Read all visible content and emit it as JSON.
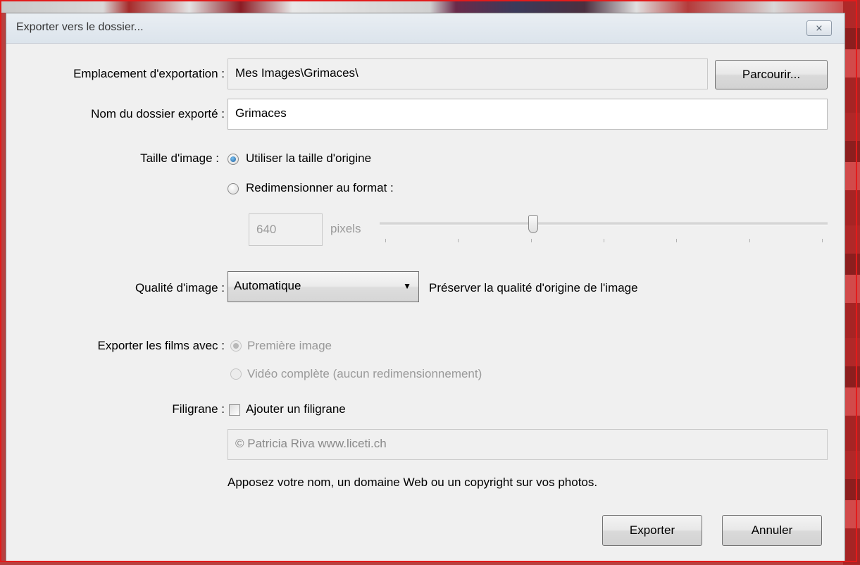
{
  "window": {
    "title": "Exporter vers le dossier...",
    "close_glyph": "⨯"
  },
  "export_location": {
    "label": "Emplacement d'exportation :",
    "value": "Mes Images\\Grimaces\\",
    "browse_label": "Parcourir..."
  },
  "folder_name": {
    "label": "Nom du dossier exporté :",
    "value": "Grimaces"
  },
  "image_size": {
    "label": "Taille d'image :",
    "option_original": "Utiliser la taille d'origine",
    "option_resize": "Redimensionner au format :",
    "pixels_value": "640",
    "pixels_unit": "pixels",
    "slider_fraction": 0.34
  },
  "image_quality": {
    "label": "Qualité d'image :",
    "selected": "Automatique",
    "description": "Préserver la qualité d'origine de l'image"
  },
  "movies": {
    "label": "Exporter les films avec :",
    "option_first_frame": "Première image",
    "option_full_video": "Vidéo complète (aucun redimensionnement)"
  },
  "watermark": {
    "label": "Filigrane :",
    "checkbox_label": "Ajouter un filigrane",
    "checked": false,
    "text_value": "© Patricia Riva www.liceti.ch",
    "hint": "Apposez votre nom, un domaine Web ou un copyright sur vos photos."
  },
  "buttons": {
    "export": "Exporter",
    "cancel": "Annuler"
  },
  "colors": {
    "frame_border": "#e21b1b",
    "dialog_bg": "#f0f0f0",
    "radio_selected": "#1e5e9e"
  }
}
